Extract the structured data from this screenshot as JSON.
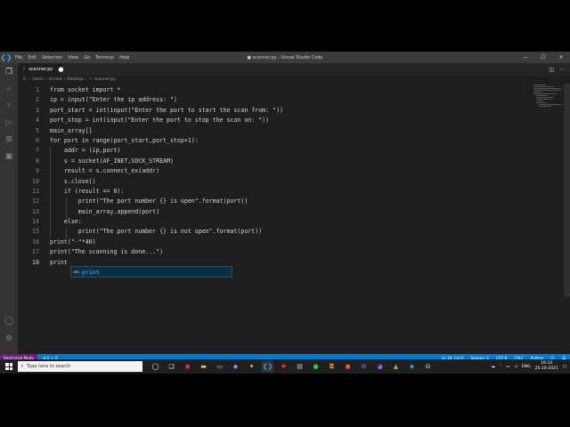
{
  "window": {
    "title": "● scanner.py - Visual Studio Code",
    "menu": [
      "File",
      "Edit",
      "Selection",
      "View",
      "Go",
      "Terminal",
      "Help"
    ]
  },
  "tab": {
    "name": "scanner.py",
    "modified_dot": "●"
  },
  "breadcrumb": [
    "C:",
    "Users",
    "Arvind",
    "Desktop",
    "scanner.py"
  ],
  "code_lines": [
    "from socket import *",
    "ip = input(\"Enter the ip address: \")",
    "port_start = int(input(\"Enter the port to start the scan from: \"))",
    "port_stop = int(input(\"Enter the port to stop the scan on: \"))",
    "main_array[]",
    "for port in range(port_start,port_stop+1):",
    "    addr = (ip,port)",
    "    s = socket(AF_INET,SOCK_STREAM)",
    "    result = s.connect_ex(addr)",
    "    s.close()",
    "    if (result == 0):",
    "        print(\"The port number {} is open\".format(port))",
    "        main_array.append(port)",
    "    else:",
    "        print(\"The port number {} is not open\".format(port))",
    "print(\"-\"*40)",
    "print(\"The scanning is done...\")",
    "print"
  ],
  "line_numbers": [
    "1",
    "2",
    "3",
    "4",
    "5",
    "6",
    "7",
    "8",
    "9",
    "10",
    "11",
    "12",
    "13",
    "14",
    "15",
    "16",
    "17",
    "18"
  ],
  "suggestion": {
    "label": "print",
    "kind_icon": "abc"
  },
  "statusbar": {
    "restricted": "Restricted Mode",
    "problems": "⊗ 0 ⚠ 0",
    "position": "Ln 18, Col 6",
    "spaces": "Spaces: 4",
    "encoding": "UTF-8",
    "eol": "CRLF",
    "language": "Python"
  },
  "taskbar": {
    "search_placeholder": "Type here to search",
    "lang": "ENG",
    "time": "16:33",
    "date": "25-10-2021"
  },
  "colors": {
    "accent": "#007acc",
    "restricted": "#68217a",
    "editor_bg": "#1e1e1e"
  }
}
